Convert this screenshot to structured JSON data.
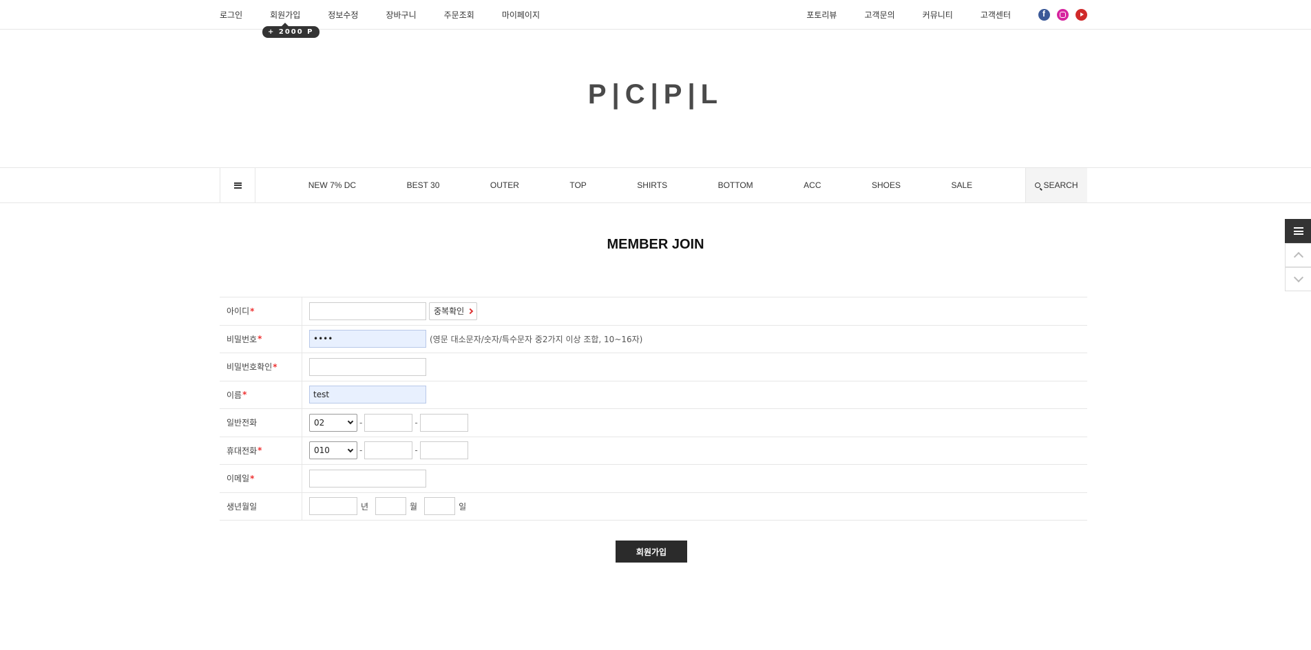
{
  "top_nav": {
    "left": [
      "로그인",
      "회원가입",
      "정보수정",
      "장바구니",
      "주문조회",
      "마이페이지"
    ],
    "right": [
      "포토리뷰",
      "고객문의",
      "커뮤니티",
      "고객센터"
    ],
    "social_icons": [
      "facebook-icon",
      "instagram-icon",
      "youtube-icon"
    ],
    "point_badge": "+ 2000 P"
  },
  "logo": "P|C|P|L",
  "main_nav": {
    "items": [
      "NEW 7% DC",
      "BEST 30",
      "OUTER",
      "TOP",
      "SHIRTS",
      "BOTTOM",
      "ACC",
      "SHOES",
      "SALE"
    ],
    "search_label": "SEARCH"
  },
  "page_title": "MEMBER JOIN",
  "form": {
    "id_label": "아이디",
    "id_value": "",
    "dup_check_label": "중복확인",
    "password_label": "비밀번호",
    "password_value": "••••",
    "password_hint": "(영문 대소문자/숫자/특수문자 중2가지 이상 조합, 10~16자)",
    "password_confirm_label": "비밀번호확인",
    "name_label": "이름",
    "name_value": "test",
    "phone_label": "일반전화",
    "phone_prefix": "02",
    "mobile_label": "휴대전화",
    "mobile_prefix": "010",
    "email_label": "이메일",
    "birthday_label": "생년월일",
    "year_unit": "년",
    "month_unit": "월",
    "day_unit": "일",
    "required_mark": "*",
    "dash": "-"
  },
  "submit_label": "회원가입",
  "colors": {
    "accent_dark": "#2b2b2b",
    "required": "#e33333",
    "autofill": "#e8f0fe"
  }
}
